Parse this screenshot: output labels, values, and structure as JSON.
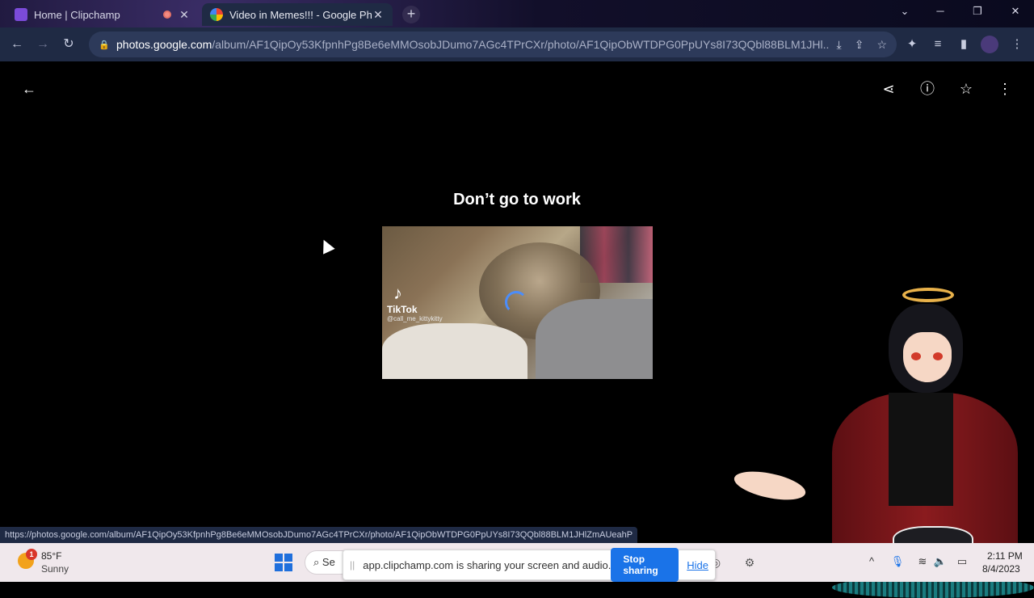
{
  "browser": {
    "tabs": [
      {
        "title": "Home | Clipchamp",
        "favicon_color": "#7b4bd9",
        "recording": true
      },
      {
        "title": "Video in Memes!!! - Google Phot",
        "favicon_color": "#f4b400",
        "active": true
      }
    ],
    "new_tab_label": "+",
    "address": {
      "host": "photos.google.com",
      "path": "/album/AF1QipOy53KfpnhPg8Be6eMMOsobJDumo7AGc4TPrCXr/photo/AF1QipObWTDPG0PpUYs8I73QQbl88BLM1JHl..."
    },
    "window_controls": {
      "minimize": "─",
      "restore": "❐",
      "close": "✕",
      "tab_list": "⌄"
    }
  },
  "viewer": {
    "caption": "Don’t go to work",
    "video_overlay": {
      "brand": "TikTok",
      "handle": "@call_me_kittykitty",
      "logo_glyph": "♪"
    },
    "icons": {
      "back": "←",
      "share": "⋖",
      "info": "ⓘ",
      "favorite": "☆",
      "more": "⋮"
    }
  },
  "status_url": "https://photos.google.com/album/AF1QipOy53KfpnhPg8Be6eMMOsobJDumo7AGc4TPrCXr/photo/AF1QipObWTDPG0PpUYs8I73QQbl88BLM1JHlZmAUeahP",
  "taskbar": {
    "weather": {
      "badge": "1",
      "temp": "85°F",
      "condition": "Sunny"
    },
    "search_label": "Se",
    "share_notice": {
      "message": "app.clipchamp.com is sharing your screen and audio.",
      "stop_label": "Stop sharing",
      "hide_label": "Hide",
      "grip": "||"
    },
    "clock": {
      "time": "2:11 PM",
      "date": "8/4/2023"
    },
    "tray": {
      "chevron": "^",
      "mic": "🎙",
      "wifi": "≋",
      "volume": "🔈",
      "battery": "▭"
    }
  },
  "colors": {
    "accent": "#1a73e8",
    "toolbar": "#1f2a44",
    "taskbar": "#f0e8ec"
  }
}
